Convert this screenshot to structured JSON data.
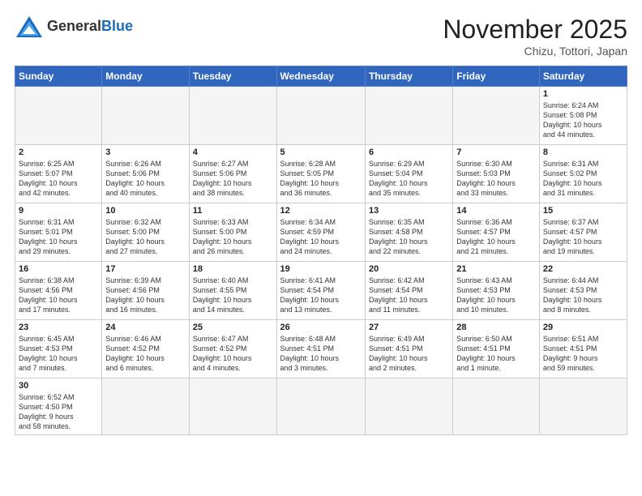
{
  "header": {
    "logo_general": "General",
    "logo_blue": "Blue",
    "month_title": "November 2025",
    "location": "Chizu, Tottori, Japan"
  },
  "days_of_week": [
    "Sunday",
    "Monday",
    "Tuesday",
    "Wednesday",
    "Thursday",
    "Friday",
    "Saturday"
  ],
  "weeks": [
    [
      {
        "day": "",
        "info": ""
      },
      {
        "day": "",
        "info": ""
      },
      {
        "day": "",
        "info": ""
      },
      {
        "day": "",
        "info": ""
      },
      {
        "day": "",
        "info": ""
      },
      {
        "day": "",
        "info": ""
      },
      {
        "day": "1",
        "info": "Sunrise: 6:24 AM\nSunset: 5:08 PM\nDaylight: 10 hours\nand 44 minutes."
      }
    ],
    [
      {
        "day": "2",
        "info": "Sunrise: 6:25 AM\nSunset: 5:07 PM\nDaylight: 10 hours\nand 42 minutes."
      },
      {
        "day": "3",
        "info": "Sunrise: 6:26 AM\nSunset: 5:06 PM\nDaylight: 10 hours\nand 40 minutes."
      },
      {
        "day": "4",
        "info": "Sunrise: 6:27 AM\nSunset: 5:06 PM\nDaylight: 10 hours\nand 38 minutes."
      },
      {
        "day": "5",
        "info": "Sunrise: 6:28 AM\nSunset: 5:05 PM\nDaylight: 10 hours\nand 36 minutes."
      },
      {
        "day": "6",
        "info": "Sunrise: 6:29 AM\nSunset: 5:04 PM\nDaylight: 10 hours\nand 35 minutes."
      },
      {
        "day": "7",
        "info": "Sunrise: 6:30 AM\nSunset: 5:03 PM\nDaylight: 10 hours\nand 33 minutes."
      },
      {
        "day": "8",
        "info": "Sunrise: 6:31 AM\nSunset: 5:02 PM\nDaylight: 10 hours\nand 31 minutes."
      }
    ],
    [
      {
        "day": "9",
        "info": "Sunrise: 6:31 AM\nSunset: 5:01 PM\nDaylight: 10 hours\nand 29 minutes."
      },
      {
        "day": "10",
        "info": "Sunrise: 6:32 AM\nSunset: 5:00 PM\nDaylight: 10 hours\nand 27 minutes."
      },
      {
        "day": "11",
        "info": "Sunrise: 6:33 AM\nSunset: 5:00 PM\nDaylight: 10 hours\nand 26 minutes."
      },
      {
        "day": "12",
        "info": "Sunrise: 6:34 AM\nSunset: 4:59 PM\nDaylight: 10 hours\nand 24 minutes."
      },
      {
        "day": "13",
        "info": "Sunrise: 6:35 AM\nSunset: 4:58 PM\nDaylight: 10 hours\nand 22 minutes."
      },
      {
        "day": "14",
        "info": "Sunrise: 6:36 AM\nSunset: 4:57 PM\nDaylight: 10 hours\nand 21 minutes."
      },
      {
        "day": "15",
        "info": "Sunrise: 6:37 AM\nSunset: 4:57 PM\nDaylight: 10 hours\nand 19 minutes."
      }
    ],
    [
      {
        "day": "16",
        "info": "Sunrise: 6:38 AM\nSunset: 4:56 PM\nDaylight: 10 hours\nand 17 minutes."
      },
      {
        "day": "17",
        "info": "Sunrise: 6:39 AM\nSunset: 4:56 PM\nDaylight: 10 hours\nand 16 minutes."
      },
      {
        "day": "18",
        "info": "Sunrise: 6:40 AM\nSunset: 4:55 PM\nDaylight: 10 hours\nand 14 minutes."
      },
      {
        "day": "19",
        "info": "Sunrise: 6:41 AM\nSunset: 4:54 PM\nDaylight: 10 hours\nand 13 minutes."
      },
      {
        "day": "20",
        "info": "Sunrise: 6:42 AM\nSunset: 4:54 PM\nDaylight: 10 hours\nand 11 minutes."
      },
      {
        "day": "21",
        "info": "Sunrise: 6:43 AM\nSunset: 4:53 PM\nDaylight: 10 hours\nand 10 minutes."
      },
      {
        "day": "22",
        "info": "Sunrise: 6:44 AM\nSunset: 4:53 PM\nDaylight: 10 hours\nand 8 minutes."
      }
    ],
    [
      {
        "day": "23",
        "info": "Sunrise: 6:45 AM\nSunset: 4:53 PM\nDaylight: 10 hours\nand 7 minutes."
      },
      {
        "day": "24",
        "info": "Sunrise: 6:46 AM\nSunset: 4:52 PM\nDaylight: 10 hours\nand 6 minutes."
      },
      {
        "day": "25",
        "info": "Sunrise: 6:47 AM\nSunset: 4:52 PM\nDaylight: 10 hours\nand 4 minutes."
      },
      {
        "day": "26",
        "info": "Sunrise: 6:48 AM\nSunset: 4:51 PM\nDaylight: 10 hours\nand 3 minutes."
      },
      {
        "day": "27",
        "info": "Sunrise: 6:49 AM\nSunset: 4:51 PM\nDaylight: 10 hours\nand 2 minutes."
      },
      {
        "day": "28",
        "info": "Sunrise: 6:50 AM\nSunset: 4:51 PM\nDaylight: 10 hours\nand 1 minute."
      },
      {
        "day": "29",
        "info": "Sunrise: 6:51 AM\nSunset: 4:51 PM\nDaylight: 9 hours\nand 59 minutes."
      }
    ],
    [
      {
        "day": "30",
        "info": "Sunrise: 6:52 AM\nSunset: 4:50 PM\nDaylight: 9 hours\nand 58 minutes."
      },
      {
        "day": "",
        "info": ""
      },
      {
        "day": "",
        "info": ""
      },
      {
        "day": "",
        "info": ""
      },
      {
        "day": "",
        "info": ""
      },
      {
        "day": "",
        "info": ""
      },
      {
        "day": "",
        "info": ""
      }
    ]
  ]
}
